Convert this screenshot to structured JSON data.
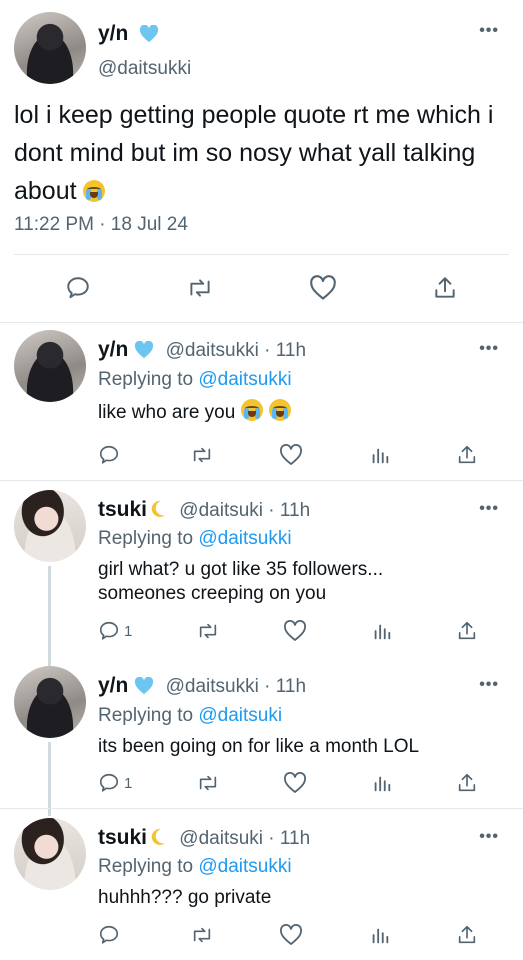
{
  "main_tweet": {
    "name": "y/n",
    "handle": "@daitsukki",
    "text": "lol i keep getting people quote rt me which i dont mind but im so nosy what yall talking about",
    "time": "11:22 PM · 18 Jul 24"
  },
  "replies": [
    {
      "name": "y/n",
      "handle_time": "@daitsukki · 11h",
      "replying_prefix": "Replying to",
      "replying_to": "@daitsukki",
      "text": "like who are you",
      "reply_count": ""
    },
    {
      "name": "tsuki",
      "handle_time": "@daitsuki · 11h",
      "replying_prefix": "Replying to",
      "replying_to": "@daitsukki",
      "text": "girl what? u got like 35 followers... someones creeping on you",
      "reply_count": "1"
    },
    {
      "name": "y/n",
      "handle_time": "@daitsukki · 11h",
      "replying_prefix": "Replying to",
      "replying_to": "@daitsuki",
      "text": "its been going on for like a month LOL",
      "reply_count": "1"
    },
    {
      "name": "tsuki",
      "handle_time": "@daitsuki · 11h",
      "replying_prefix": "Replying to",
      "replying_to": "@daitsukki",
      "text": "huhhh??? go private",
      "reply_count": ""
    }
  ],
  "icons": {
    "reply": "reply-icon",
    "retweet": "retweet-icon",
    "like": "heart-icon",
    "views": "analytics-icon",
    "share": "share-icon",
    "verified": "verified-heart-icon",
    "more": "more-icon"
  },
  "colors": {
    "link": "#1d9bf0",
    "verified": "#6ec6f0",
    "muted": "#536471",
    "moon": "#f2c230"
  }
}
